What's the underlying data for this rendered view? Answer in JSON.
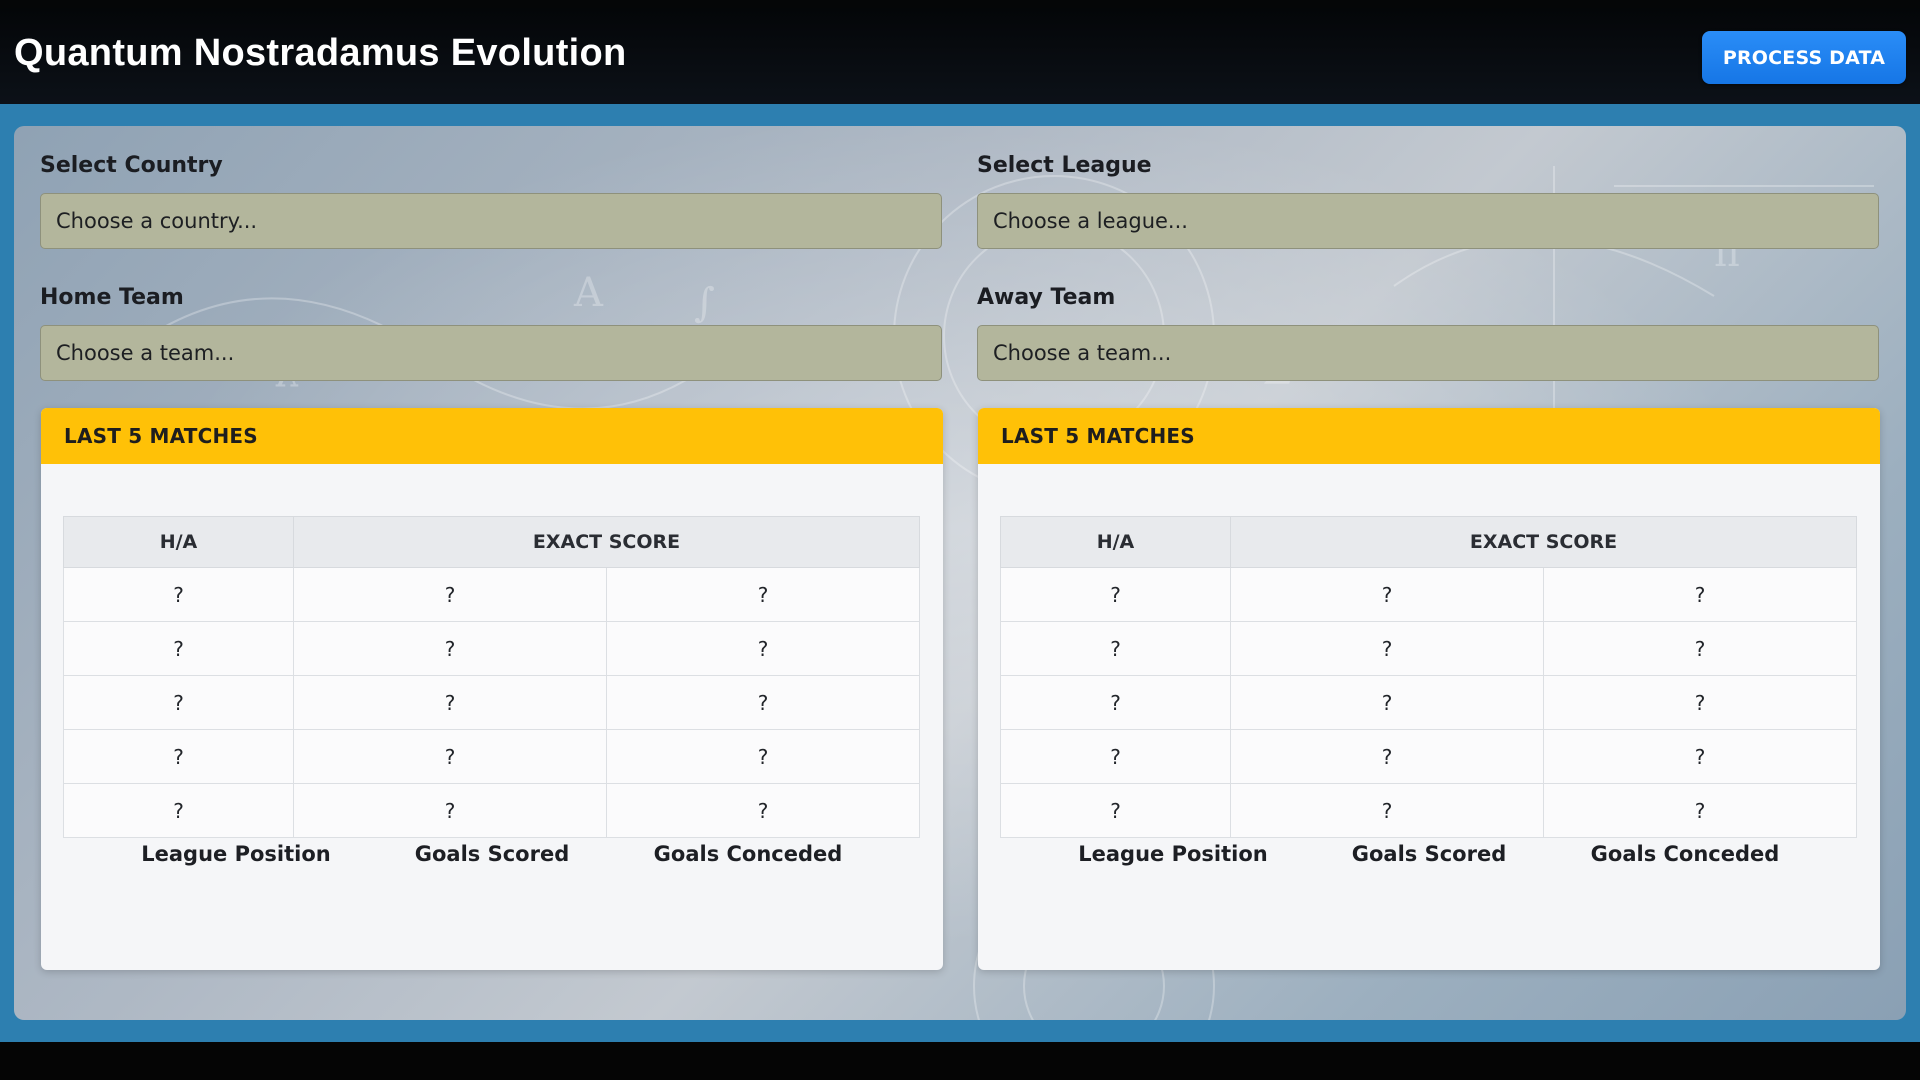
{
  "header": {
    "title": "Quantum Nostradamus Evolution",
    "process_button": "PROCESS DATA"
  },
  "form": {
    "country": {
      "label": "Select Country",
      "value": "Choose a country..."
    },
    "league": {
      "label": "Select League",
      "value": "Choose a league..."
    },
    "home_team": {
      "label": "Home Team",
      "value": "Choose a team..."
    },
    "away_team": {
      "label": "Away Team",
      "value": "Choose a team..."
    }
  },
  "home_card": {
    "title": "LAST 5 MATCHES",
    "columns": {
      "ha": "H/A",
      "exact_score": "EXACT SCORE"
    },
    "rows": [
      [
        "?",
        "?",
        "?"
      ],
      [
        "?",
        "?",
        "?"
      ],
      [
        "?",
        "?",
        "?"
      ],
      [
        "?",
        "?",
        "?"
      ],
      [
        "?",
        "?",
        "?"
      ]
    ],
    "stats": {
      "league_position": "League Position",
      "goals_scored": "Goals Scored",
      "goals_conceded": "Goals Conceded"
    }
  },
  "away_card": {
    "title": "LAST 5 MATCHES",
    "columns": {
      "ha": "H/A",
      "exact_score": "EXACT SCORE"
    },
    "rows": [
      [
        "?",
        "?",
        "?"
      ],
      [
        "?",
        "?",
        "?"
      ],
      [
        "?",
        "?",
        "?"
      ],
      [
        "?",
        "?",
        "?"
      ],
      [
        "?",
        "?",
        "?"
      ]
    ],
    "stats": {
      "league_position": "League Position",
      "goals_scored": "Goals Scored",
      "goals_conceded": "Goals Conceded"
    }
  },
  "colors": {
    "accent": "#ffc107",
    "button": "#1e82f0",
    "select_bg": "#b3b69c",
    "page_bg": "#2d7fb0"
  }
}
